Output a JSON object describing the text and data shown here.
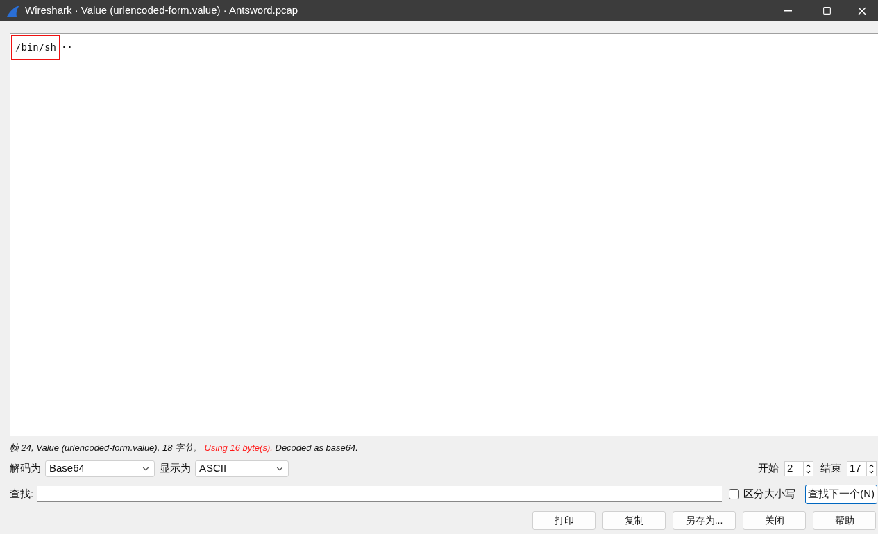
{
  "window": {
    "title": "Wireshark · Value (urlencoded-form.value) · Antsword.pcap"
  },
  "content": {
    "highlighted": "/bin/sh",
    "rest": "··"
  },
  "status": {
    "info": "帧 24, Value (urlencoded-form.value), 18 字节。",
    "warning": "Using 16 byte(s).",
    "decoded": "Decoded as base64."
  },
  "decode_as": {
    "label": "解码为",
    "value": "Base64"
  },
  "show_as": {
    "label": "显示为",
    "value": "ASCII"
  },
  "start": {
    "label": "开始",
    "value": "2"
  },
  "end": {
    "label": "结束",
    "value": "17"
  },
  "find": {
    "label": "查找:",
    "case_sensitive": {
      "label": "区分大小写",
      "checked": false
    },
    "next_button": "查找下一个(N)"
  },
  "buttons": [
    "打印",
    "复制",
    "另存为...",
    "关闭",
    "帮助"
  ]
}
